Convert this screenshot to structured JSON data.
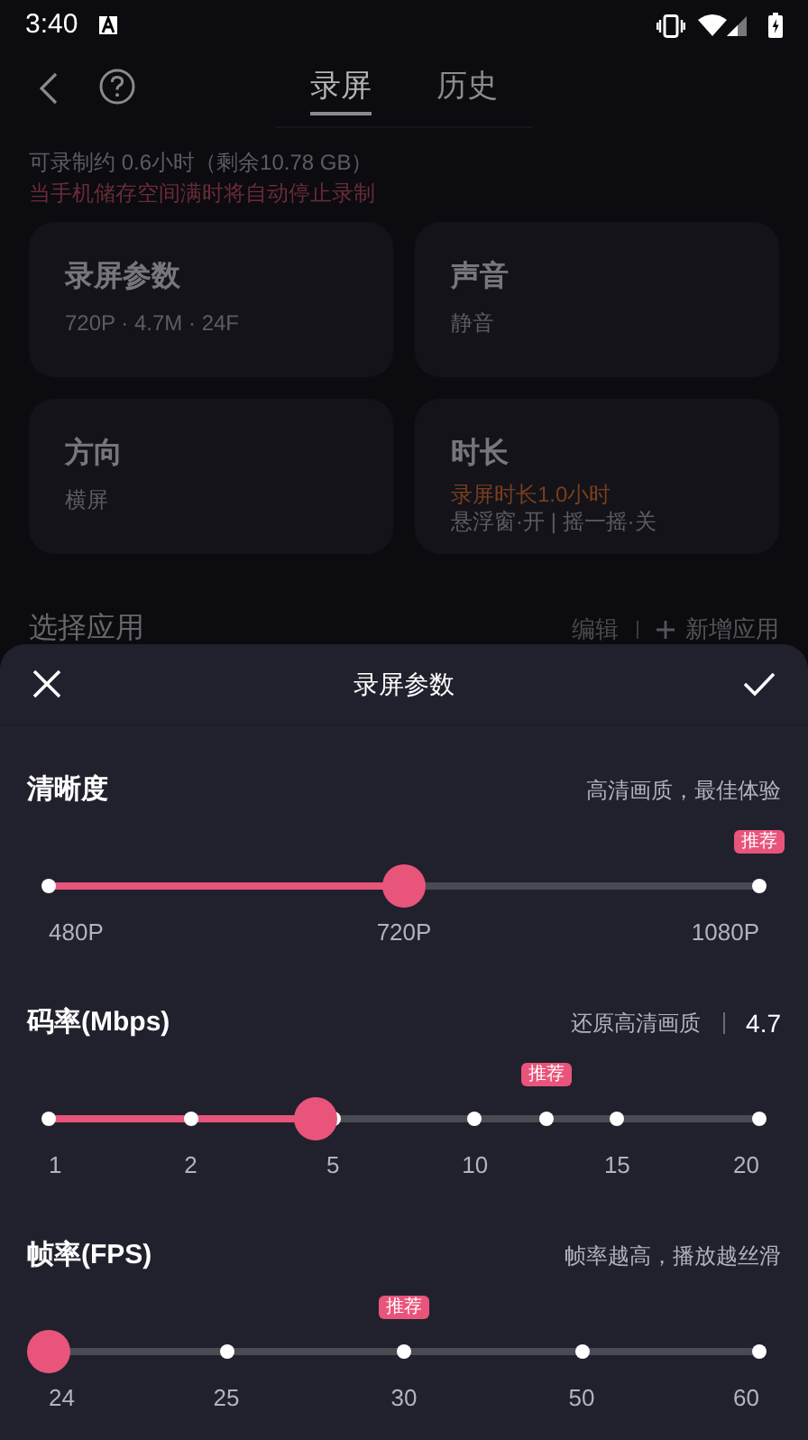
{
  "status_bar": {
    "time": "3:40"
  },
  "header": {
    "tabs": [
      {
        "label": "录屏",
        "selected": true
      },
      {
        "label": "历史",
        "selected": false
      }
    ]
  },
  "info": {
    "capacity": "可录制约 0.6小时（剩余10.78 GB）",
    "warning": "当手机储存空间满时将自动停止录制"
  },
  "cards": [
    {
      "title": "录屏参数",
      "lines": [
        {
          "kind": "normal",
          "text": "720P · 4.7M · 24F"
        }
      ]
    },
    {
      "title": "声音",
      "lines": [
        {
          "kind": "normal",
          "text": "静音"
        }
      ]
    },
    {
      "title": "方向",
      "lines": [
        {
          "kind": "normal",
          "text": "横屏"
        }
      ]
    },
    {
      "title": "时长",
      "lines": [
        {
          "kind": "highlight",
          "text": "录屏时长1.0小时"
        },
        {
          "kind": "normal",
          "text": "悬浮窗·开 | 摇一摇·关"
        }
      ]
    }
  ],
  "apps_section": {
    "title": "选择应用",
    "edit": "编辑",
    "add": "新增应用"
  },
  "sheet": {
    "title": "录屏参数",
    "settings": [
      {
        "label": "清晰度",
        "hint": "高清画质，最佳体验",
        "badge": "推荐",
        "level": 0.5,
        "ticks": [
          {
            "label": "480P",
            "recommended": false
          },
          {
            "label": "720P",
            "recommended": false
          },
          {
            "label": "1080P",
            "recommended": true
          }
        ]
      },
      {
        "label": "码率(Mbps)",
        "hint": "还原高清画质",
        "value": "4.7",
        "badge": "推荐",
        "level": 0.375,
        "ticks": [
          {
            "label": "1",
            "recommended": false
          },
          {
            "label": "2",
            "recommended": false
          },
          {
            "label": "5",
            "recommended": false
          },
          {
            "label": "10",
            "recommended": false
          },
          {
            "recommended": true
          },
          {
            "label": "15",
            "recommended": false
          },
          {
            "label": "20",
            "recommended": false
          }
        ]
      },
      {
        "label": "帧率(FPS)",
        "hint": "帧率越高，播放越丝滑",
        "badge": "推荐",
        "level": 0,
        "ticks": [
          {
            "label": "24",
            "recommended": false
          },
          {
            "label": "25",
            "recommended": false
          },
          {
            "label": "30",
            "recommended": true
          },
          {
            "label": "50",
            "recommended": false
          },
          {
            "label": "60",
            "recommended": false
          }
        ]
      }
    ]
  }
}
